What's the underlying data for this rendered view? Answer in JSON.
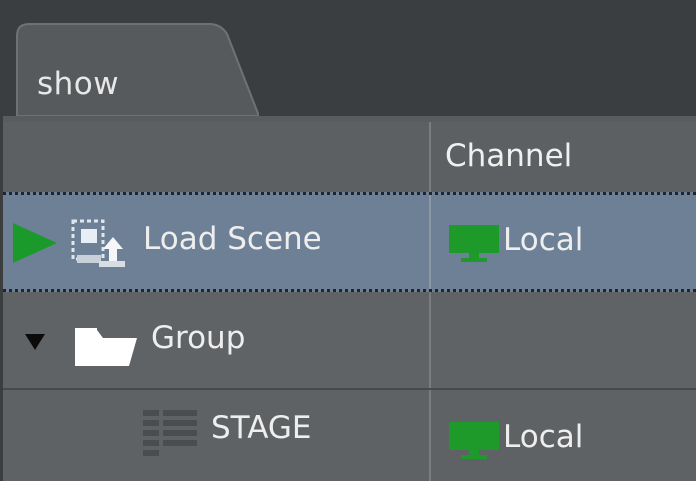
{
  "tabs": [
    {
      "label": "show"
    }
  ],
  "table": {
    "columns": [
      "",
      "Channel"
    ],
    "rows": [
      {
        "name": "Load Scene",
        "channel": "Local",
        "selected": true,
        "icon": "load-scene-icon",
        "marker": "play-icon"
      },
      {
        "name": "Group",
        "channel": "",
        "selected": false,
        "icon": "folder-icon",
        "marker": "expand-triangle-icon"
      },
      {
        "name": "STAGE",
        "channel": "Local",
        "selected": false,
        "icon": "stage-icon",
        "marker": ""
      }
    ]
  },
  "colors": {
    "selection": "#6e8096",
    "play": "#1a9a2b",
    "monitor": "#1d9a2a",
    "background": "#5e6163"
  }
}
